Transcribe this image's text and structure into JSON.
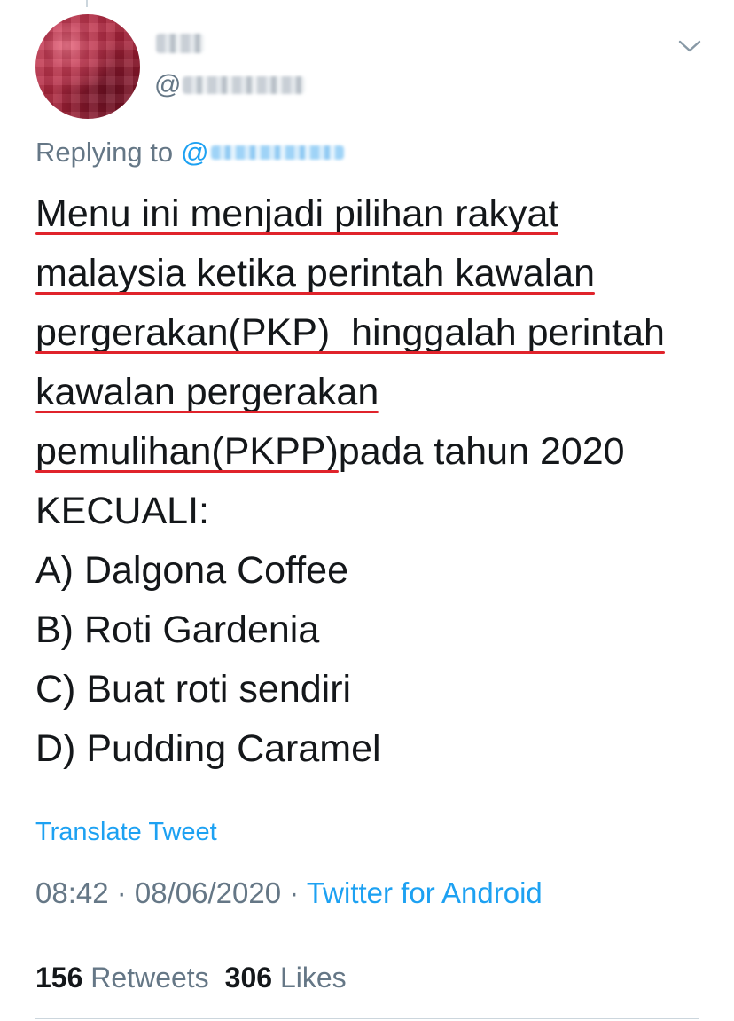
{
  "tweet": {
    "author": {
      "handle_prefix": "@"
    },
    "chevron_icon": "chevron-down-icon",
    "replying_to_label": "Replying to",
    "replying_to_prefix": "@",
    "text_lines": [
      "Menu ini menjadi pilihan rakyat",
      "malaysia ketika perintah kawalan",
      "pergerakan(PKP)  hinggalah perintah",
      "kawalan pergerakan",
      "pemulihan(PKPP)",
      "pada tahun 2020",
      "KECUALI:",
      "A) Dalgona Coffee",
      "B) Roti Gardenia",
      "C) Buat roti sendiri",
      "D) Pudding Caramel"
    ],
    "translate_label": "Translate Tweet",
    "time": "08:42",
    "separator": " · ",
    "date": "08/06/2020",
    "source": "Twitter for Android",
    "retweets_count": "156",
    "retweets_label": "Retweets",
    "likes_count": "306",
    "likes_label": "Likes"
  },
  "colors": {
    "link": "#1da1f2",
    "muted": "#657786",
    "text": "#14171a",
    "underline_annotation": "#e0232b",
    "divider": "#ccd6dd"
  }
}
